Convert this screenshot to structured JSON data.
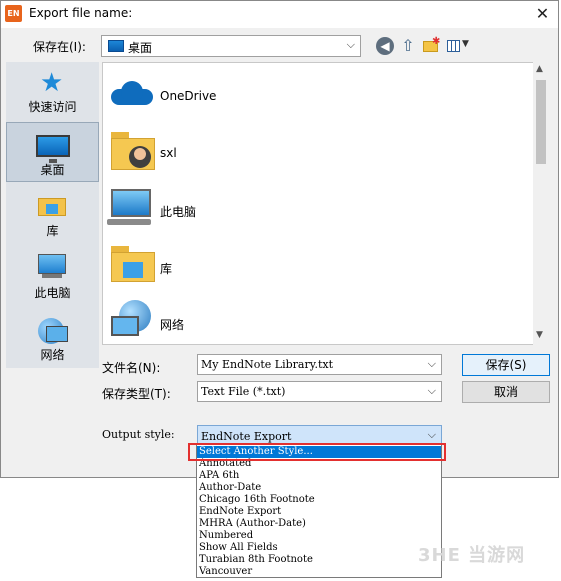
{
  "window": {
    "title": "Export file name:",
    "app_badge": "EN",
    "close_label": "✕"
  },
  "toolbar": {
    "save_in_label": "保存在(I):",
    "save_in_value": "桌面",
    "back_icon": "back-arrow-icon",
    "up_icon": "up-folder-icon",
    "new_folder_icon": "new-folder-icon",
    "view_icon": "view-menu-icon"
  },
  "places": [
    {
      "label": "快速访问",
      "icon": "quick-access-star-icon",
      "selected": false
    },
    {
      "label": "桌面",
      "icon": "desktop-icon",
      "selected": true
    },
    {
      "label": "库",
      "icon": "library-icon",
      "selected": false
    },
    {
      "label": "此电脑",
      "icon": "computer-icon",
      "selected": false
    },
    {
      "label": "网络",
      "icon": "network-icon",
      "selected": false
    }
  ],
  "files": [
    {
      "label": "OneDrive",
      "icon": "onedrive-cloud-icon"
    },
    {
      "label": "sxl",
      "icon": "user-folder-icon"
    },
    {
      "label": "此电脑",
      "icon": "computer-icon"
    },
    {
      "label": "库",
      "icon": "library-icon"
    },
    {
      "label": "网络",
      "icon": "network-icon"
    }
  ],
  "form": {
    "filename_label": "文件名(N):",
    "filename_value": "My EndNote Library.txt",
    "filetype_label": "保存类型(T):",
    "filetype_value": "Text File (*.txt)",
    "save_button": "保存(S)",
    "cancel_button": "取消"
  },
  "output_style": {
    "label": "Output style:",
    "value": "EndNote Export",
    "options": [
      "Select Another Style...",
      "Annotated",
      "APA 6th",
      "Author-Date",
      "Chicago 16th Footnote",
      "EndNote Export",
      "MHRA (Author-Date)",
      "Numbered",
      "Show All Fields",
      "Turabian 8th Footnote",
      "Vancouver"
    ],
    "highlighted_index": 0
  },
  "watermark": "3HE 当游网",
  "colors": {
    "highlight": "#0078d7",
    "annotation_box": "#e3302f",
    "selected_place": "#c9d3de"
  }
}
